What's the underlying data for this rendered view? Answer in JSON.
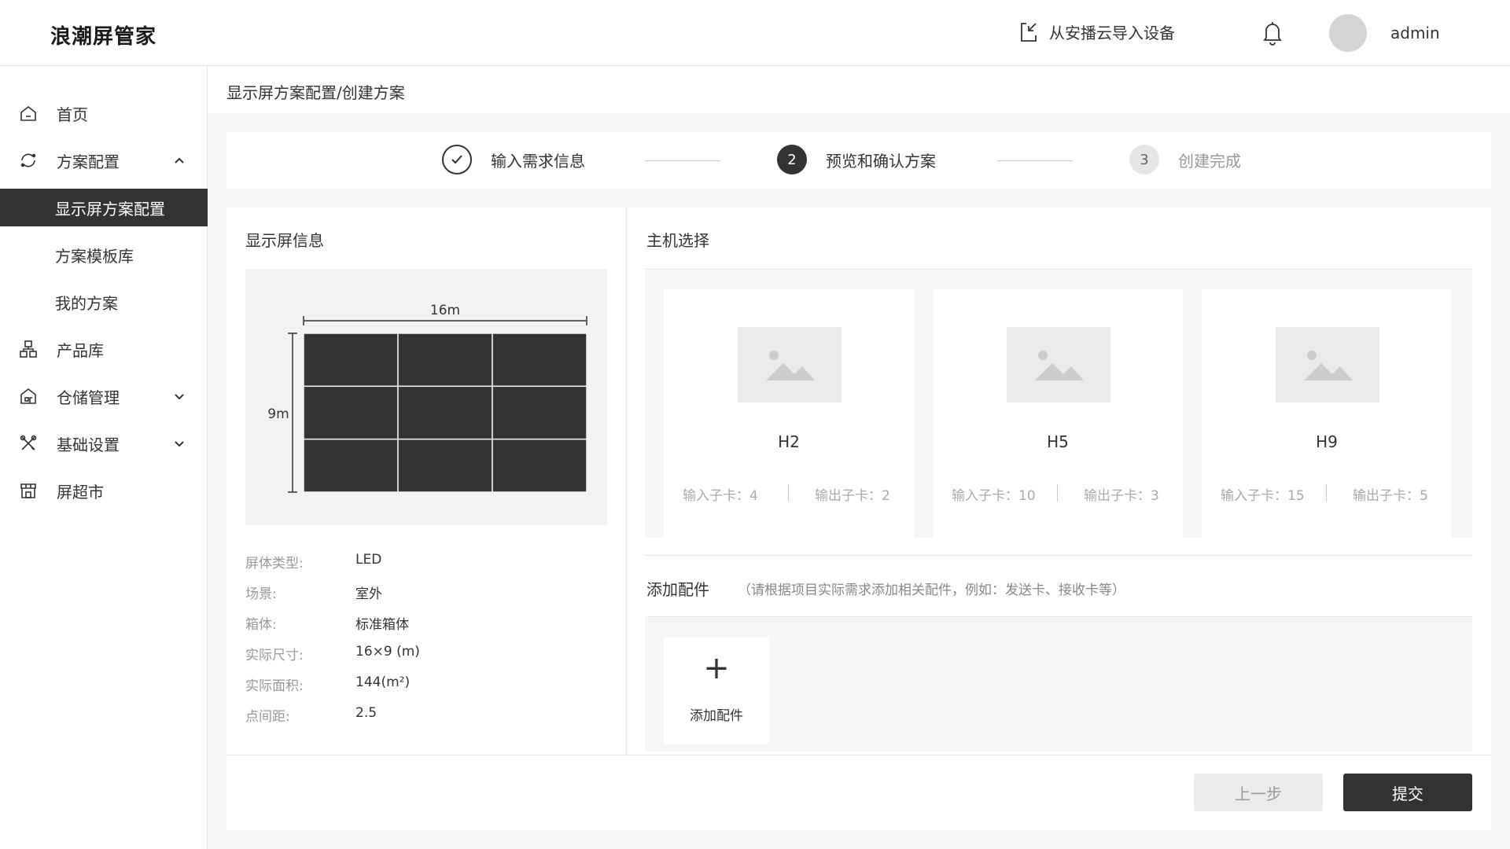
{
  "header": {
    "app_title": "浪潮屏管家",
    "import_label": "从安播云导入设备",
    "username": "admin"
  },
  "sidebar": {
    "items": [
      {
        "label": "首页"
      },
      {
        "label": "方案配置"
      },
      {
        "label": "显示屏方案配置"
      },
      {
        "label": "方案模板库"
      },
      {
        "label": "我的方案"
      },
      {
        "label": "产品库"
      },
      {
        "label": "仓储管理"
      },
      {
        "label": "基础设置"
      },
      {
        "label": "屏超市"
      }
    ]
  },
  "breadcrumb": "显示屏方案配置/创建方案",
  "steps": [
    {
      "num": "",
      "label": "输入需求信息",
      "state": "done"
    },
    {
      "num": "2",
      "label": "预览和确认方案",
      "state": "active"
    },
    {
      "num": "3",
      "label": "创建完成",
      "state": "pending"
    }
  ],
  "screen_info": {
    "title": "显示屏信息",
    "width_label": "16m",
    "height_label": "9m",
    "grid_rows": 3,
    "grid_cols": 3,
    "specs": [
      {
        "label": "屏体类型:",
        "value": "LED"
      },
      {
        "label": "场景:",
        "value": "室外"
      },
      {
        "label": "箱体:",
        "value": "标准箱体"
      },
      {
        "label": "实际尺寸:",
        "value": "16×9 (m)"
      },
      {
        "label": "实际面积:",
        "value": "144(m²)"
      },
      {
        "label": "点间距:",
        "value": "2.5"
      }
    ]
  },
  "host": {
    "title": "主机选择",
    "cards": [
      {
        "name": "H2",
        "in": "输入子卡：4",
        "out": "输出子卡：2"
      },
      {
        "name": "H5",
        "in": "输入子卡：10",
        "out": "输出子卡：3"
      },
      {
        "name": "H9",
        "in": "输入子卡：15",
        "out": "输出子卡：5"
      }
    ]
  },
  "accessory": {
    "title": "添加配件",
    "hint": "（请根据项目实际需求添加相关配件，例如：发送卡、接收卡等）",
    "add_symbol": "+",
    "add_label": "添加配件"
  },
  "actions": {
    "prev": "上一步",
    "submit": "提交"
  },
  "colors": {
    "primary": "#333333",
    "screen_panel": "#333333",
    "active_nav_bg": "#333333"
  }
}
